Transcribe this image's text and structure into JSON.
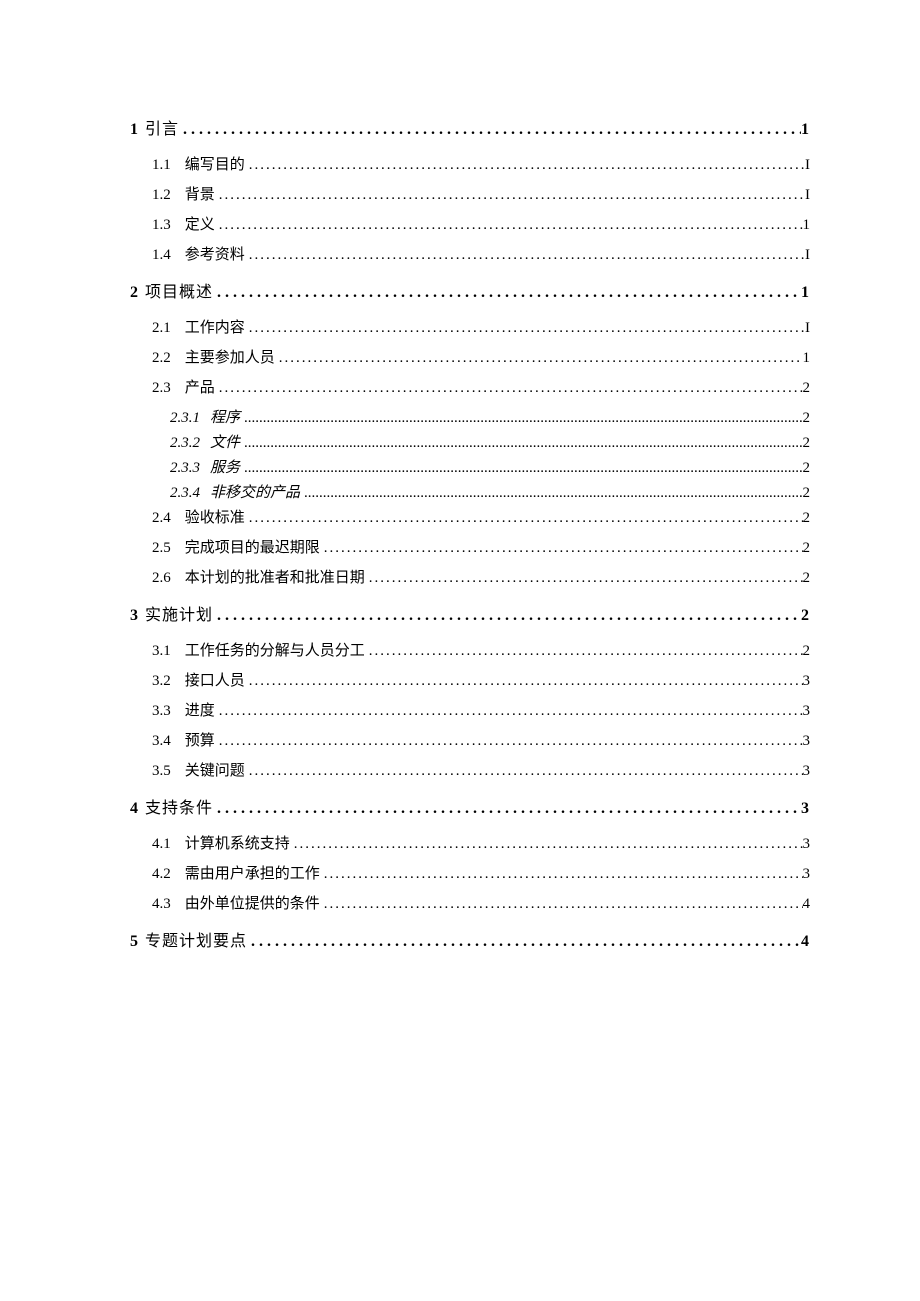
{
  "toc": [
    {
      "level": 1,
      "num": "1",
      "title": "引言",
      "page": "1"
    },
    {
      "level": 2,
      "num": "1.1",
      "title": "编写目的",
      "page": "I"
    },
    {
      "level": 2,
      "num": "1.2",
      "title": "背景",
      "page": "I"
    },
    {
      "level": 2,
      "num": "1.3",
      "title": "定义",
      "page": "1"
    },
    {
      "level": 2,
      "num": "1.4",
      "title": "参考资料",
      "page": "I"
    },
    {
      "level": 1,
      "num": "2",
      "title": "项目概述",
      "page": "1"
    },
    {
      "level": 2,
      "num": "2.1",
      "title": "工作内容",
      "page": "I"
    },
    {
      "level": 2,
      "num": "2.2",
      "title": "主要参加人员",
      "page": "1"
    },
    {
      "level": 2,
      "num": "2.3",
      "title": "产品",
      "page": "2"
    },
    {
      "level": 3,
      "num": "2.3.1",
      "title": "程序",
      "page": "2"
    },
    {
      "level": 3,
      "num": "2.3.2",
      "title": "文件",
      "page": "2"
    },
    {
      "level": 3,
      "num": "2.3.3",
      "title": "服务",
      "page": "2"
    },
    {
      "level": 3,
      "num": "2.3.4",
      "title": "非移交的产品",
      "page": "2"
    },
    {
      "level": 2,
      "num": "2.4",
      "title": "验收标准",
      "page": "2"
    },
    {
      "level": 2,
      "num": "2.5",
      "title": "完成项目的最迟期限",
      "page": "2"
    },
    {
      "level": 2,
      "num": "2.6",
      "title": "本计划的批准者和批准日期",
      "page": "2"
    },
    {
      "level": 1,
      "num": "3",
      "title": "实施计划",
      "page": "2"
    },
    {
      "level": 2,
      "num": "3.1",
      "title": "工作任务的分解与人员分工",
      "page": "2"
    },
    {
      "level": 2,
      "num": "3.2",
      "title": "接口人员",
      "page": "3"
    },
    {
      "level": 2,
      "num": "3.3",
      "title": "进度",
      "page": "3"
    },
    {
      "level": 2,
      "num": "3.4",
      "title": "预算",
      "page": "3"
    },
    {
      "level": 2,
      "num": "3.5",
      "title": "关键问题",
      "page": "3"
    },
    {
      "level": 1,
      "num": "4",
      "title": "支持条件",
      "page": "3"
    },
    {
      "level": 2,
      "num": "4.1",
      "title": "计算机系统支持",
      "page": "3"
    },
    {
      "level": 2,
      "num": "4.2",
      "title": "需由用户承担的工作",
      "page": "3"
    },
    {
      "level": 2,
      "num": "4.3",
      "title": "由外单位提供的条件",
      "page": "4"
    },
    {
      "level": 1,
      "num": "5",
      "title": "专题计划要点",
      "page": "4"
    }
  ],
  "dots": "................................................................................................................................................................"
}
